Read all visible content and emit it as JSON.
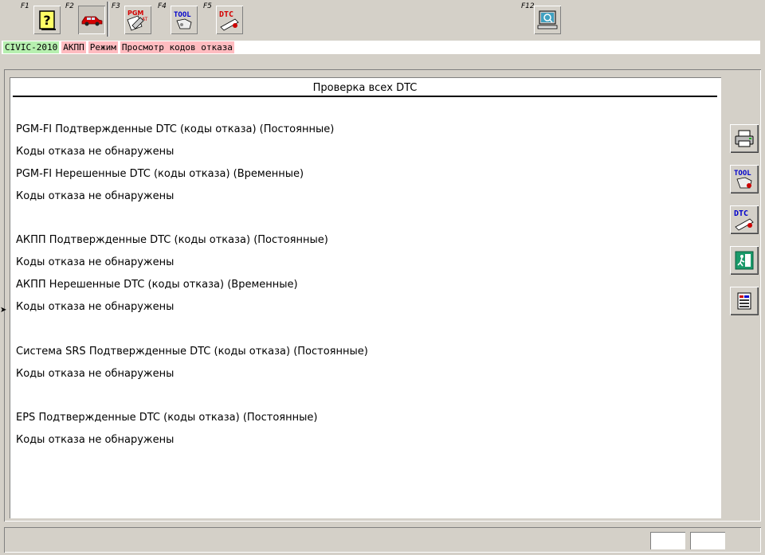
{
  "toolbar": {
    "keys": [
      {
        "key": "F1",
        "icon": "help-question-icon"
      },
      {
        "key": "F2",
        "icon": "car-icon"
      },
      {
        "key": "F3",
        "icon": "pgm-at-system-icon"
      },
      {
        "key": "F4",
        "icon": "tool-icon"
      },
      {
        "key": "F5",
        "icon": "dtc-icon"
      },
      {
        "key": "F12",
        "icon": "monitor-search-icon"
      }
    ]
  },
  "status": {
    "model": "CIVIC-2010",
    "system": "АКПП",
    "mode_label": "Режим",
    "mode_value": "Просмотр кодов отказа"
  },
  "panel": {
    "title": "Проверка всех DTC",
    "lines": [
      "PGM-FI Подтвержденные DTC (коды отказа) (Постоянные)",
      "Коды отказа не обнаружены",
      "PGM-FI Нерешенные DTC (коды отказа) (Временные)",
      "Коды отказа не обнаружены",
      "АКПП Подтвержденные DTC (коды отказа) (Постоянные)",
      "Коды отказа не обнаружены",
      "АКПП Нерешенные DTC (коды отказа) (Временные)",
      "Коды отказа не обнаружены",
      "Система SRS Подтвержденные DTC (коды отказа) (Постоянные)",
      "Коды отказа не обнаружены",
      "EPS Подтвержденные DTC (коды отказа) (Постоянные)",
      "Коды отказа не обнаружены"
    ]
  },
  "side_buttons": [
    "printer-icon",
    "tool-icon",
    "dtc-icon",
    "exit-icon",
    "data-list-icon"
  ],
  "colors": {
    "model_bg": "#b7f0b0",
    "tag_bg": "#ffbcc0",
    "window_bg": "#d4d0c8"
  }
}
